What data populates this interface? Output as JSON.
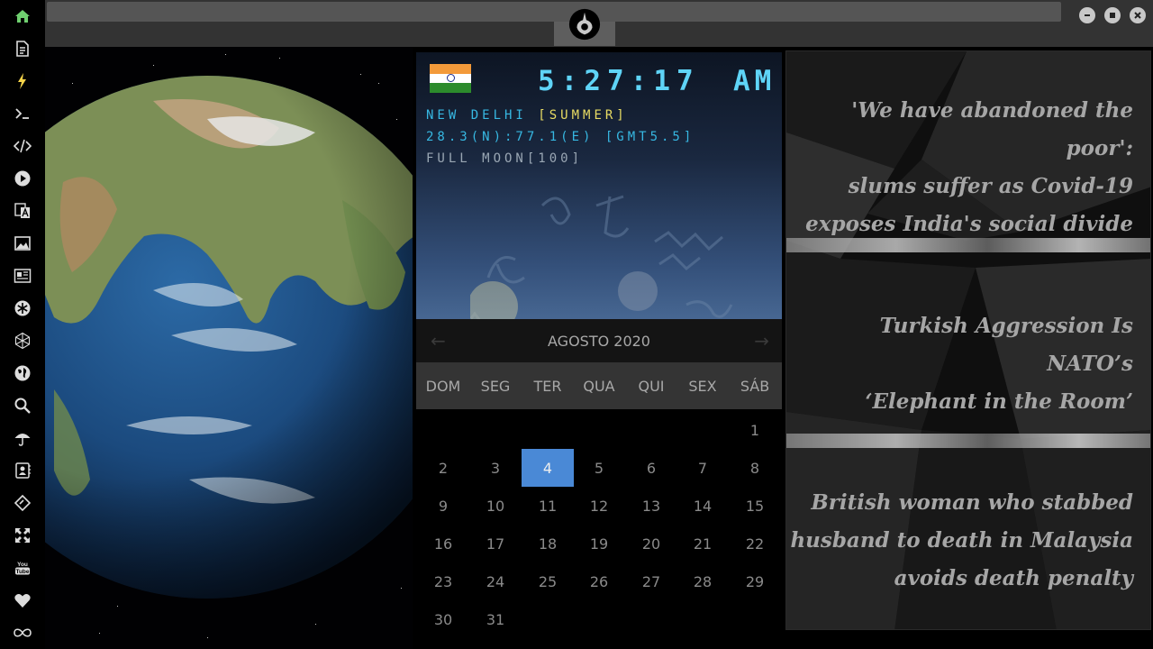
{
  "clock": {
    "time": "5:27:17",
    "ampm": "AM",
    "city": "NEW DELHI",
    "season": "[SUMMER]",
    "coords": "28.3(N):77.1(E) [GMT5.5]",
    "moon": "FULL MOON[100]"
  },
  "calendar": {
    "title": "AGOSTO 2020",
    "prev_icon": "arrow-left-icon",
    "next_icon": "arrow-right-icon",
    "weekdays": [
      "DOM",
      "SEG",
      "TER",
      "QUA",
      "QUI",
      "SEX",
      "SÁB"
    ],
    "weeks": [
      [
        "",
        "",
        "",
        "",
        "",
        "",
        "1"
      ],
      [
        "2",
        "3",
        "4",
        "5",
        "6",
        "7",
        "8"
      ],
      [
        "9",
        "10",
        "11",
        "12",
        "13",
        "14",
        "15"
      ],
      [
        "16",
        "17",
        "18",
        "19",
        "20",
        "21",
        "22"
      ],
      [
        "23",
        "24",
        "25",
        "26",
        "27",
        "28",
        "29"
      ],
      [
        "30",
        "31",
        "",
        "",
        "",
        "",
        ""
      ]
    ],
    "today": "4"
  },
  "news": [
    [
      "'We have abandoned the poor':",
      "slums suffer as Covid-19",
      "exposes India's social divide"
    ],
    [
      "Turkish Aggression Is NATO’s",
      "‘Elephant in the Room’"
    ],
    [
      "British woman who stabbed",
      "husband to death in Malaysia",
      "avoids death penalty"
    ]
  ],
  "sidebar_icons": [
    "home-icon",
    "document-icon",
    "lightning-icon",
    "terminal-icon",
    "code-icon",
    "play-icon",
    "translate-icon",
    "image-icon",
    "news-icon",
    "gear-badge-icon",
    "network-icon",
    "globe-icon",
    "search-icon",
    "umbrella-icon",
    "contacts-icon",
    "tag-icon",
    "expand-icon",
    "youtube-icon",
    "heart-icon",
    "infinity-icon"
  ],
  "window_controls": [
    "minimize-icon",
    "maximize-icon",
    "close-icon"
  ],
  "colors": {
    "accent_green": "#6fcf6f",
    "lightning_yellow": "#f6d44a",
    "lcd_cyan": "#5fd4f7",
    "season_yellow": "#e8dc63",
    "today_blue": "#4a89d6"
  }
}
